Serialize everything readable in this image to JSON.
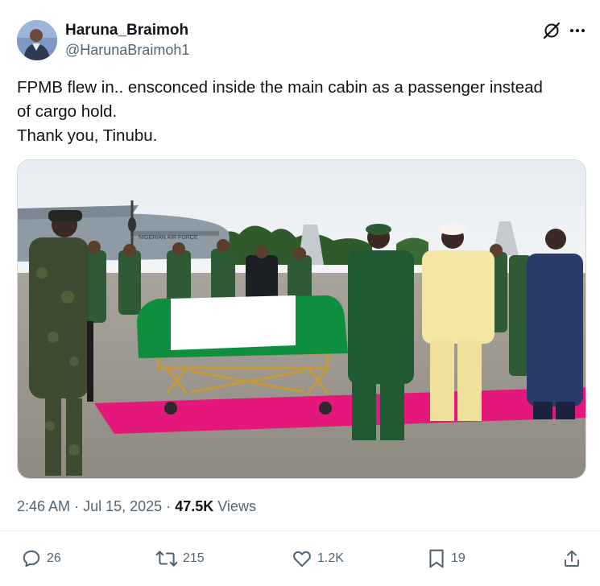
{
  "author": {
    "display_name": "Haruna_Braimoh",
    "handle": "@HarunaBraimoh1"
  },
  "tweet": {
    "lines": [
      "FPMB flew in.. ensconced inside the main cabin as a passenger instead",
      "of cargo hold.",
      "Thank you, Tinubu."
    ]
  },
  "media": {
    "aircraft_text": "NIGERIAN AIR FORCE"
  },
  "meta": {
    "time": "2:46 AM",
    "separator": "·",
    "date": "Jul 15, 2025",
    "views_count": "47.5K",
    "views_label": "Views"
  },
  "actions": {
    "replies": "26",
    "reposts": "215",
    "likes": "1.2K",
    "bookmarks": "19"
  },
  "icons": {
    "header": [
      "grok-icon",
      "more-icon"
    ],
    "actions": [
      "reply-icon",
      "repost-icon",
      "like-icon",
      "bookmark-icon",
      "share-icon"
    ]
  },
  "colors": {
    "text_primary": "#0f1419",
    "text_secondary": "#536471",
    "nigeria_green": "#0e8f3f",
    "red_carpet": "#e4187a"
  }
}
